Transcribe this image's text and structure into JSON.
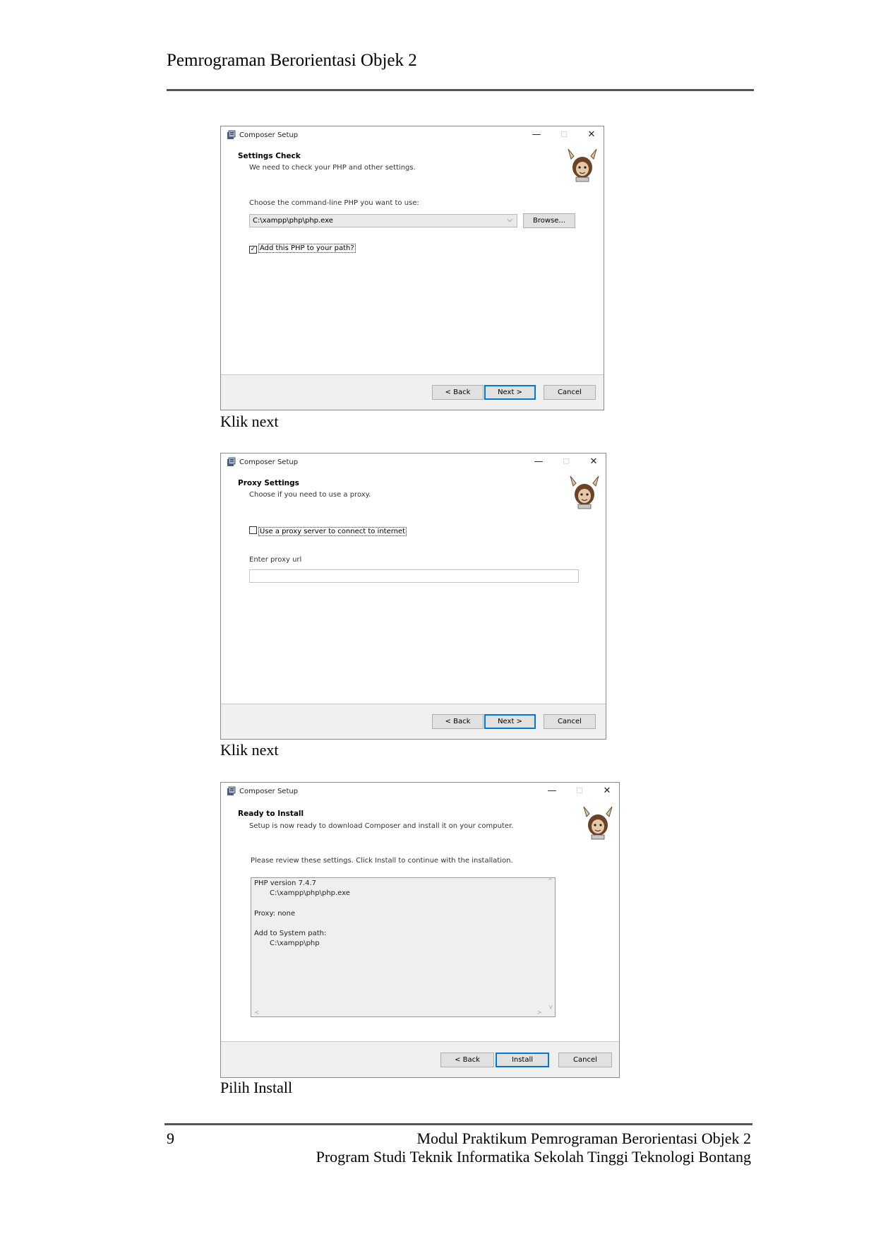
{
  "page": {
    "header_title": "Pemrograman Berorientasi Objek 2",
    "page_number": "9",
    "footer_line1": "Modul Praktikum Pemrograman Berorientasi Objek 2",
    "footer_line2": "Program Studi Teknik Informatika Sekolah Tinggi Teknologi Bontang"
  },
  "captions": [
    "Klik next",
    "Klik next",
    "Pilih Install"
  ],
  "dialog1": {
    "title": "Composer Setup",
    "heading": "Settings Check",
    "subheading": "We need to check your PHP and other settings.",
    "choose_label": "Choose the command-line PHP you want to use:",
    "php_path": "C:\\xampp\\php\\php.exe",
    "browse_label": "Browse...",
    "checkbox_label": "Add this PHP to your path?",
    "checkbox_checked": true,
    "back_label": "< Back",
    "next_label": "Next >",
    "cancel_label": "Cancel"
  },
  "dialog2": {
    "title": "Composer Setup",
    "heading": "Proxy Settings",
    "subheading": "Choose if you need to use a proxy.",
    "checkbox_label": "Use a proxy server to connect to internet",
    "checkbox_checked": false,
    "proxy_label": "Enter proxy url",
    "proxy_value": "",
    "back_label": "< Back",
    "next_label": "Next >",
    "cancel_label": "Cancel"
  },
  "dialog3": {
    "title": "Composer Setup",
    "heading": "Ready to Install",
    "subheading": "Setup is now ready to download Composer and install it on your computer.",
    "review_label": "Please review these settings. Click Install to continue with the installation.",
    "review_lines": [
      "PHP version 7.4.7",
      "C:\\xampp\\php\\php.exe",
      "Proxy: none",
      "Add to System path:",
      "C:\\xampp\\php"
    ],
    "back_label": "< Back",
    "install_label": "Install",
    "cancel_label": "Cancel"
  },
  "window_controls": {
    "minimize": "—",
    "maximize": "☐",
    "close": "✕"
  },
  "colors": {
    "focus_blue": "#0078d7",
    "button_face": "#e1e1e1",
    "rule": "#555555"
  }
}
